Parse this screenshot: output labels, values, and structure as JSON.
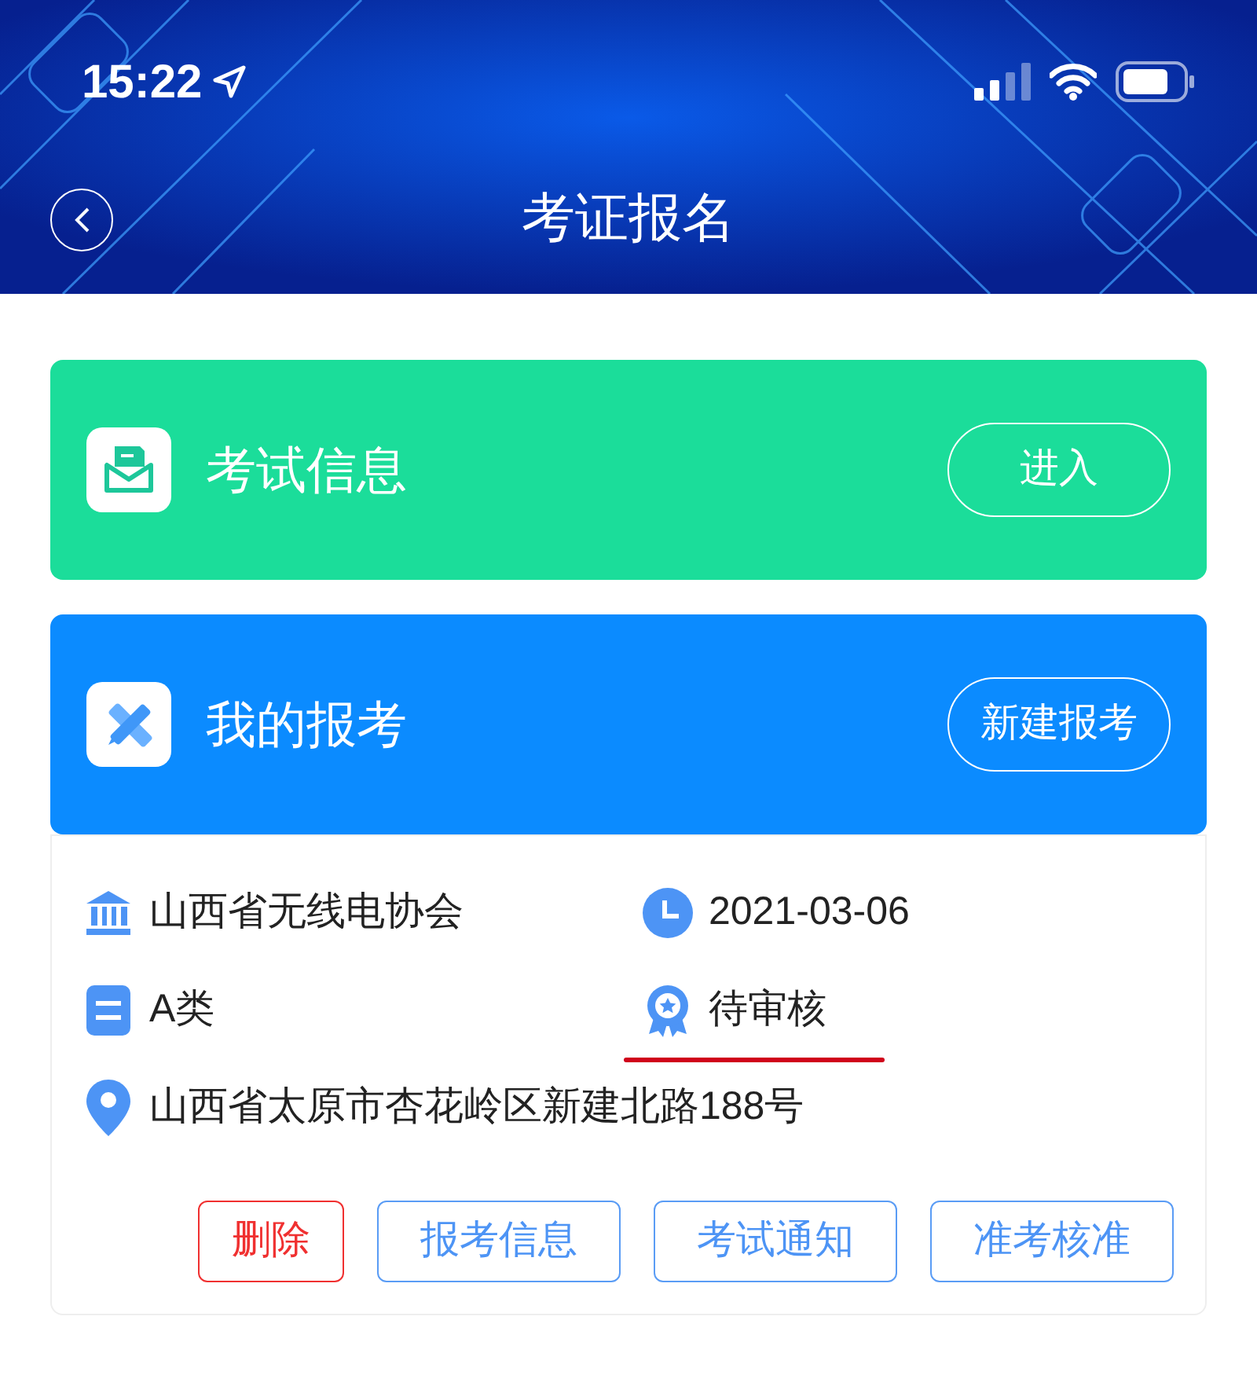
{
  "status_bar": {
    "time": "15:22"
  },
  "header": {
    "title": "考证报名"
  },
  "entries": [
    {
      "kind": "info",
      "title": "考试信息",
      "action": "进入"
    },
    {
      "kind": "mine",
      "title": "我的报考",
      "action": "新建报考"
    }
  ],
  "record": {
    "fields": [
      {
        "kind": "org",
        "text": "山西省无线电协会",
        "underlined": false
      },
      {
        "kind": "date",
        "text": "2021-03-06",
        "underlined": false
      },
      {
        "kind": "category",
        "text": "A类",
        "underlined": false
      },
      {
        "kind": "status",
        "text": "待审核",
        "underlined": true
      },
      {
        "kind": "address",
        "text": "山西省太原市杏花岭区新建北路188号",
        "underlined": false
      }
    ],
    "actions": [
      {
        "kind": "danger",
        "label": "删除"
      },
      {
        "kind": "normal",
        "label": "报考信息"
      },
      {
        "kind": "normal",
        "label": "考试通知"
      },
      {
        "kind": "normal",
        "label": "准考核准"
      }
    ]
  }
}
